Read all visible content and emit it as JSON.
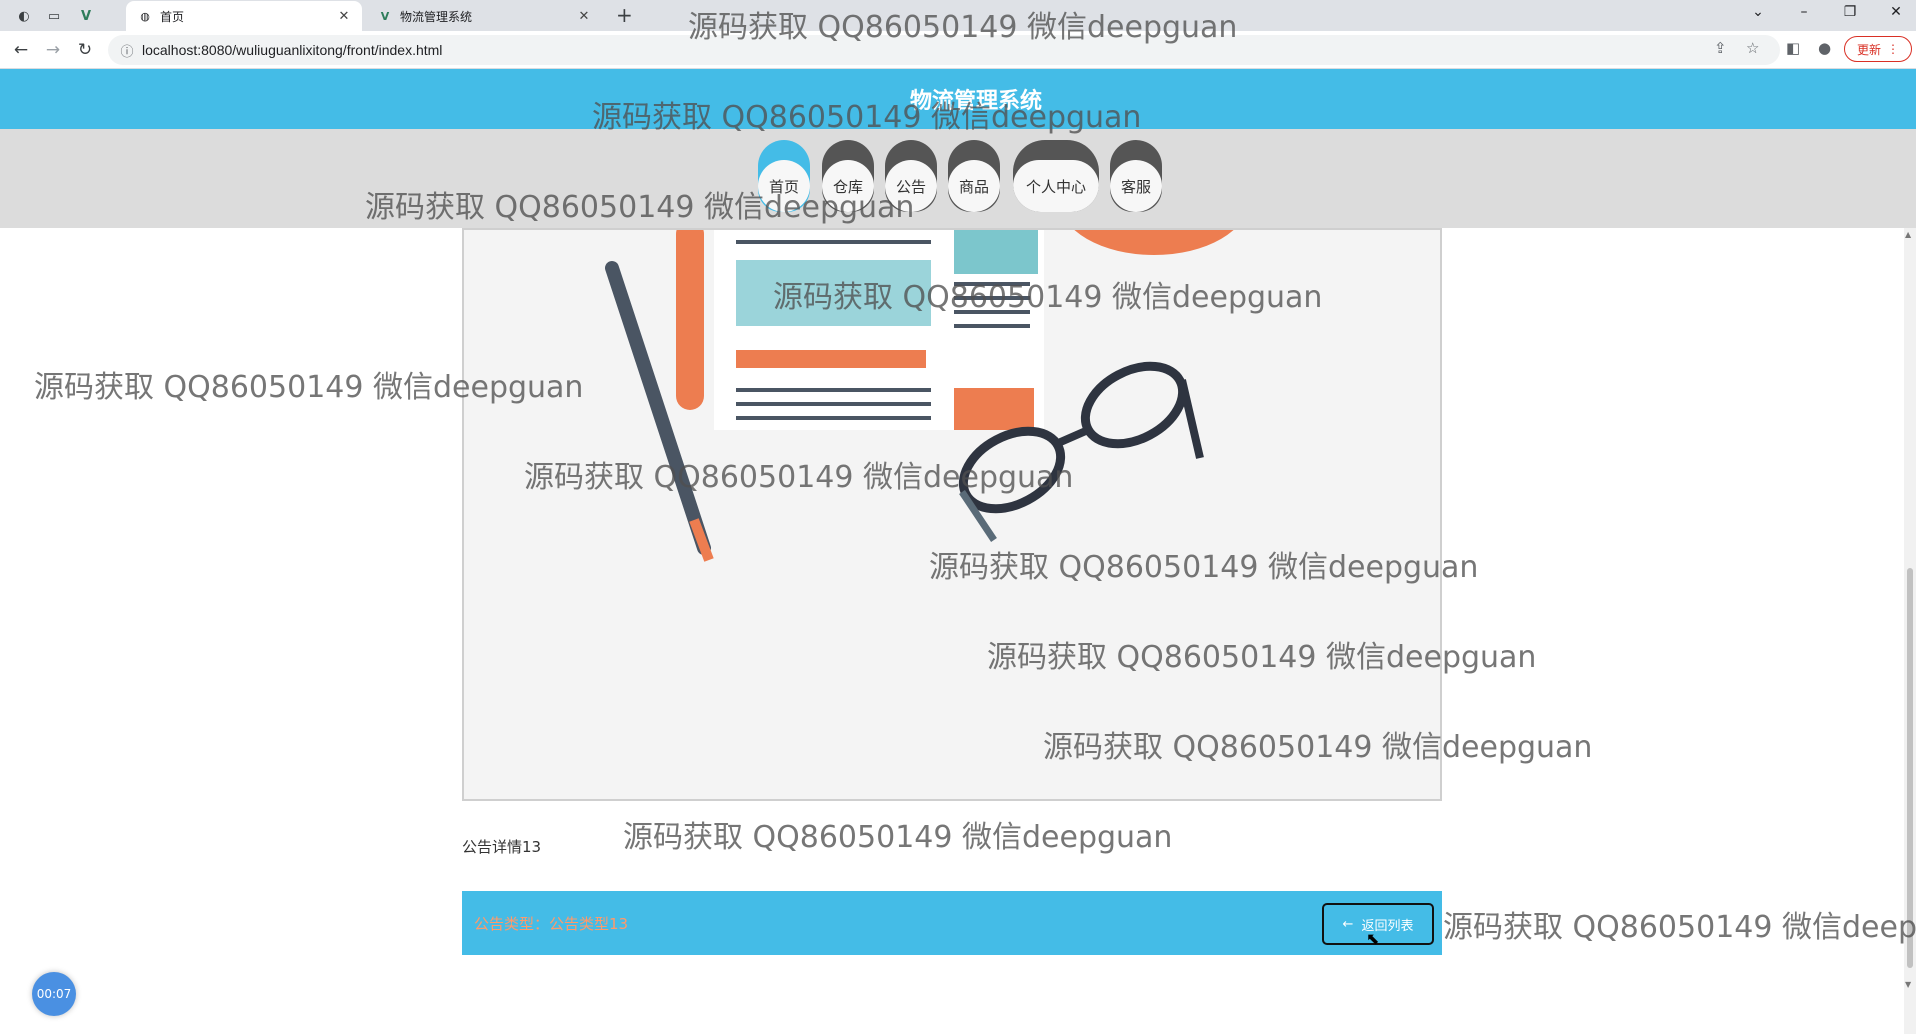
{
  "browser": {
    "tabs": [
      {
        "title": "首页",
        "active": true
      },
      {
        "title": "物流管理系统",
        "active": false
      }
    ],
    "url": "localhost:8080/wuliuguanlixitong/front/index.html",
    "update_label": "更新"
  },
  "site": {
    "title": "物流管理系统",
    "menu": [
      {
        "label": "首页",
        "active": true
      },
      {
        "label": "仓库",
        "active": false
      },
      {
        "label": "公告",
        "active": false
      },
      {
        "label": "商品",
        "active": false
      },
      {
        "label": "个人中心",
        "active": false
      },
      {
        "label": "客服",
        "active": false
      }
    ]
  },
  "detail": {
    "content": "公告详情13",
    "bar_info": "公告类型：公告类型13",
    "back_label": "返回列表"
  },
  "recording_timer": "00:07",
  "watermark": "源码获取 QQ86050149 微信deepguan",
  "colors": {
    "accent": "#44bce7",
    "menu_bg": "#dcdcdc"
  }
}
